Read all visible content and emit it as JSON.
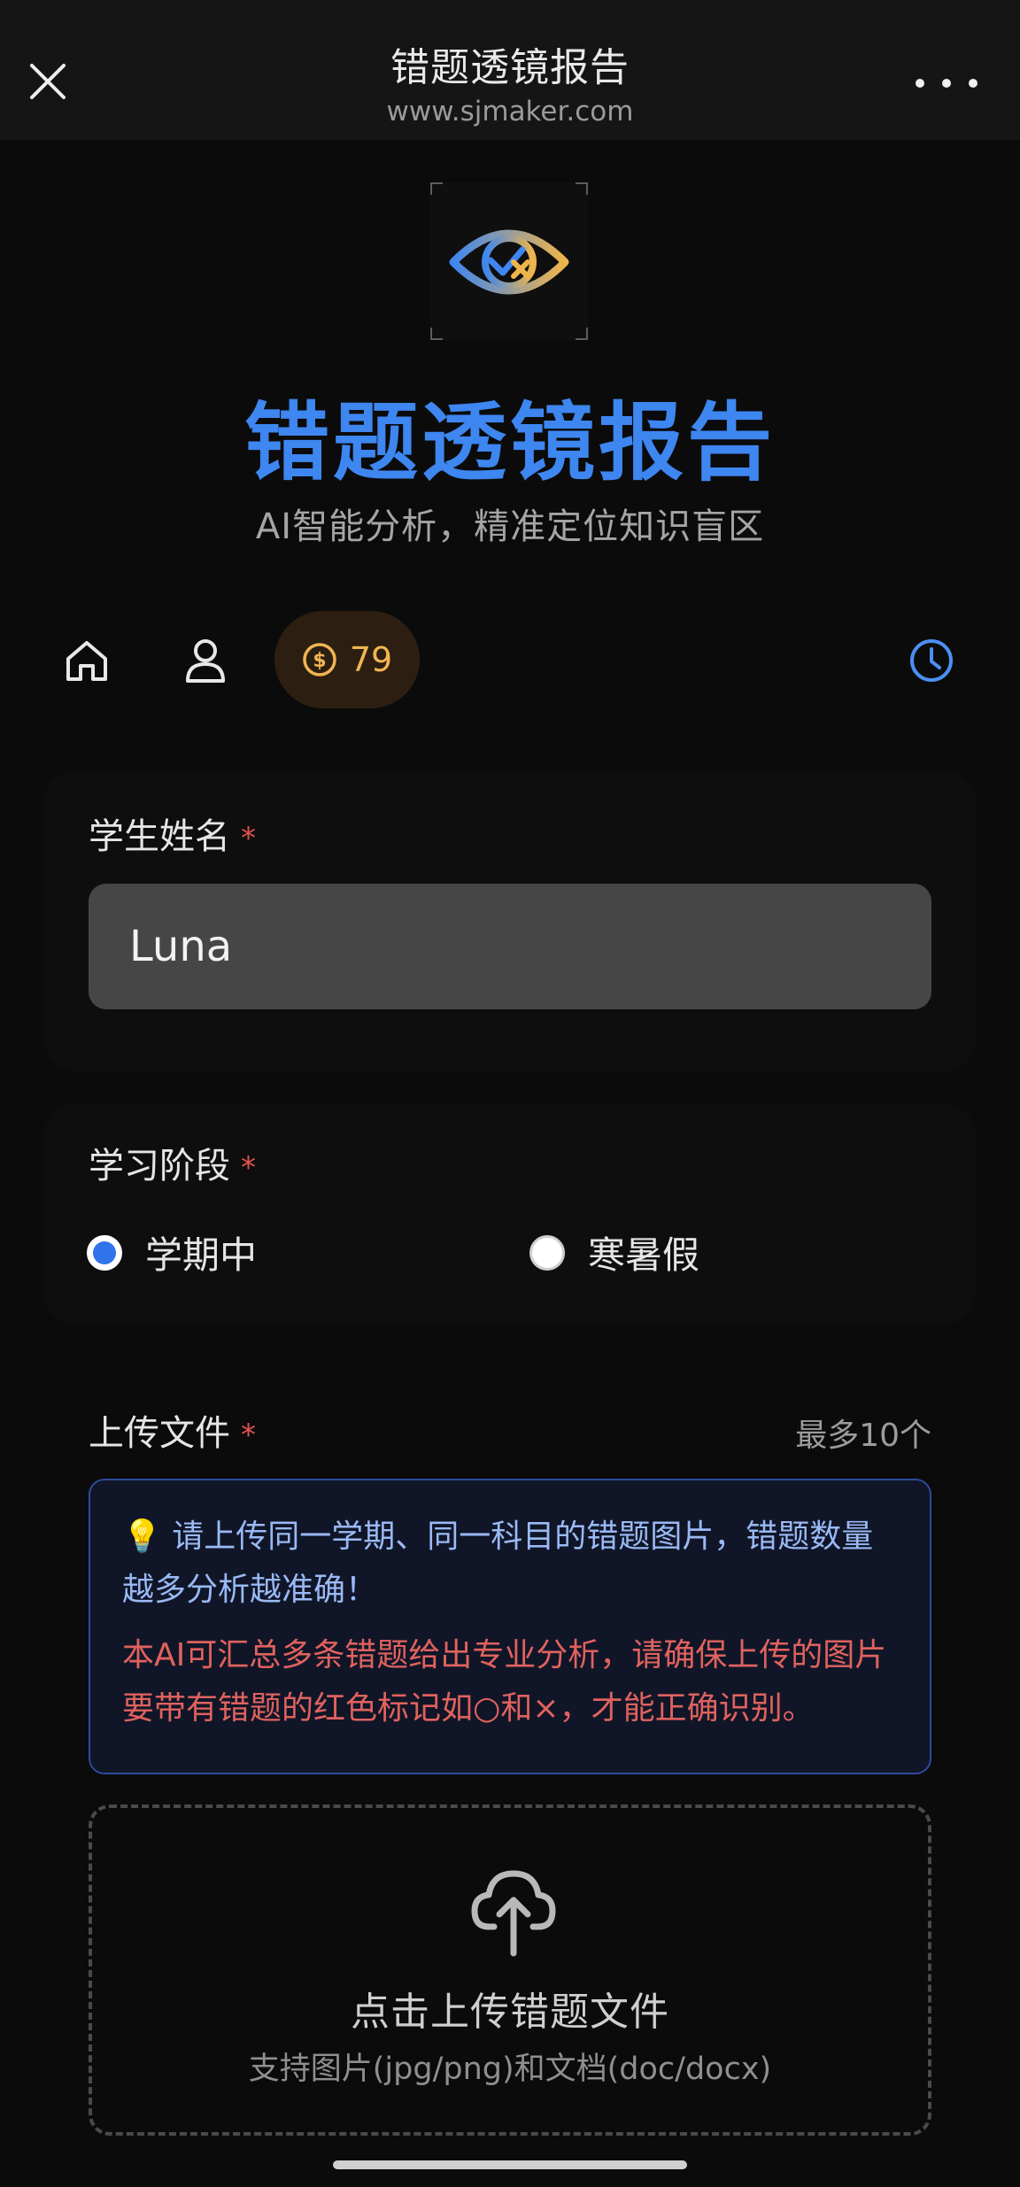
{
  "topbar": {
    "title": "错题透镜报告",
    "url": "www.sjmaker.com",
    "close_icon": "close-icon",
    "more_icon": "more-dots-icon"
  },
  "hero": {
    "logo_icon": "eye-check-cross-icon",
    "title": "错题透镜报告",
    "subtitle": "AI智能分析，精准定位知识盲区"
  },
  "nav": {
    "home_icon": "home-icon",
    "user_icon": "user-icon",
    "coin_icon": "dollar-coin-icon",
    "coin_count": "79",
    "history_icon": "clock-icon"
  },
  "form": {
    "name": {
      "label": "学生姓名",
      "required_mark": "*",
      "value": "Luna"
    },
    "stage": {
      "label": "学习阶段",
      "required_mark": "*",
      "options": [
        {
          "label": "学期中",
          "selected": true
        },
        {
          "label": "寒暑假",
          "selected": false
        }
      ]
    },
    "upload": {
      "label": "上传文件",
      "required_mark": "*",
      "max_note": "最多10个",
      "tip_main": "请上传同一学期、同一科目的错题图片，错题数量越多分析越准确！",
      "tip_warning": "本AI可汇总多条错题给出专业分析，请确保上传的图片要带有错题的红色标记如○和×，才能正确识别。",
      "dropzone_title": "点击上传错题文件",
      "dropzone_subtitle": "支持图片(jpg/png)和文档(doc/docx)"
    }
  },
  "colors": {
    "accent": "#3e86f0",
    "coin": "#f1b552",
    "required": "#e0524f",
    "tip_text": "#9ab9f4",
    "warning_text": "#e0625e"
  }
}
